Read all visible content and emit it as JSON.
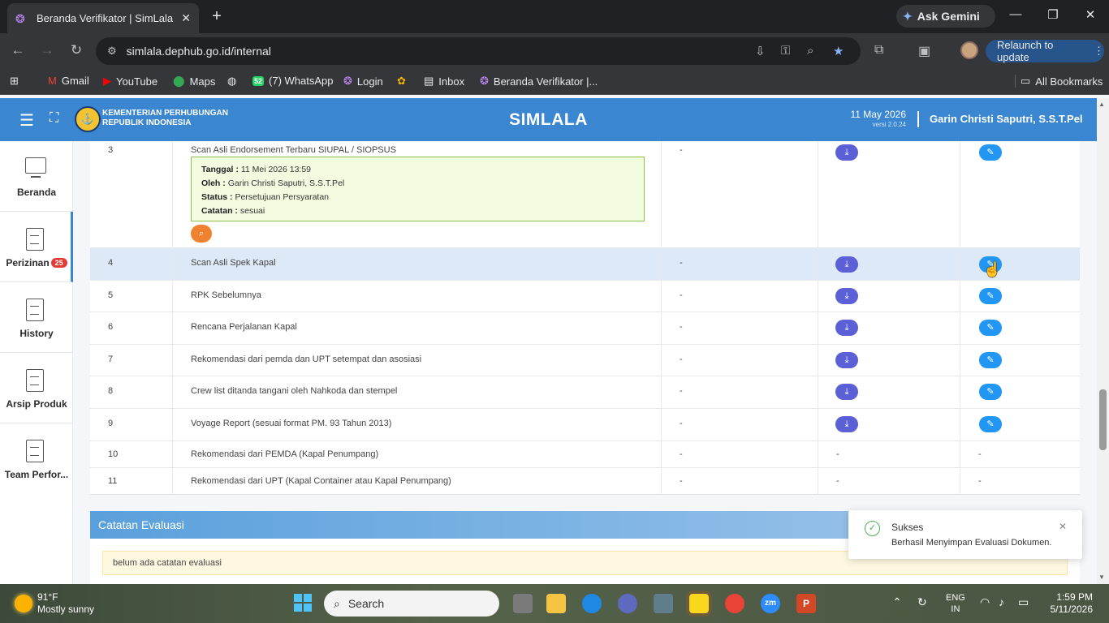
{
  "browser": {
    "tab_title": "Beranda Verifikator | SimLala",
    "ask_gemini": "Ask Gemini",
    "url": "simlala.dephub.go.id/internal",
    "relaunch": "Relaunch to update",
    "bookmarks": [
      "Gmail",
      "YouTube",
      "Maps",
      "(7) WhatsApp",
      "Login",
      "Inbox",
      "Beranda Verifikator |..."
    ],
    "whatsapp_badge": "52",
    "all_bookmarks": "All Bookmarks"
  },
  "header": {
    "ministry_line1": "KEMENTERIAN PERHUBUNGAN",
    "ministry_line2": "REPUBLIK INDONESIA",
    "app_title": "SIMLALA",
    "date": "11 May 2026",
    "version": "versi 2.0.24",
    "user": "Garin Christi Saputri, S.S.T.Pel"
  },
  "sidebar": {
    "items": [
      {
        "label": "Beranda",
        "icon": "monitor-icon"
      },
      {
        "label": "Perizinan",
        "icon": "document-icon",
        "badge": "25"
      },
      {
        "label": "History",
        "icon": "document-icon"
      },
      {
        "label": "Arsip Produk",
        "icon": "document-icon"
      },
      {
        "label": "Team Perfor...",
        "icon": "document-icon"
      }
    ]
  },
  "table": {
    "rows": [
      {
        "no": "3",
        "name": "Scan Asli Endorsement Terbaru SIUPAL / SIOPSUS",
        "dash": "-",
        "has_actions": true
      },
      {
        "no": "4",
        "name": "Scan Asli Spek Kapal",
        "dash": "-",
        "has_actions": true
      },
      {
        "no": "5",
        "name": "RPK Sebelumnya",
        "dash": "-",
        "has_actions": true
      },
      {
        "no": "6",
        "name": "Rencana Perjalanan Kapal",
        "dash": "-",
        "has_actions": true
      },
      {
        "no": "7",
        "name": "Rekomendasi dari pemda dan UPT setempat dan asosiasi",
        "dash": "-",
        "has_actions": true
      },
      {
        "no": "8",
        "name": "Crew list ditanda tangani oleh Nahkoda dan stempel",
        "dash": "-",
        "has_actions": true
      },
      {
        "no": "9",
        "name": "Voyage Report (sesuai format PM. 93 Tahun 2013)",
        "dash": "-",
        "has_actions": true
      },
      {
        "no": "10",
        "name": "Rekomendasi dari PEMDA (Kapal Penumpang)",
        "dash": "-",
        "col4": "-",
        "col5": "-"
      },
      {
        "no": "11",
        "name": "Rekomendasi dari UPT (Kapal Container atau Kapal Penumpang)",
        "dash": "-",
        "col4": "-",
        "col5": "-"
      }
    ],
    "note": {
      "tanggal_label": "Tanggal :",
      "tanggal": "11 Mei 2026 13:59",
      "oleh_label": "Oleh :",
      "oleh": "Garin Christi Saputri, S.S.T.Pel",
      "status_label": "Status :",
      "status": "Persetujuan Persyaratan",
      "catatan_label": "Catatan :",
      "catatan": "sesuai"
    }
  },
  "evaluation": {
    "title": "Catatan Evaluasi",
    "empty_note": "belum ada catatan evaluasi"
  },
  "toast": {
    "title": "Sukses",
    "message": "Berhasil Menyimpan Evaluasi Dokumen."
  },
  "taskbar": {
    "temperature": "91°F",
    "weather": "Mostly sunny",
    "search": "Search",
    "lang1": "ENG",
    "lang2": "IN",
    "time": "1:59 PM",
    "date": "5/11/2026"
  },
  "colors": {
    "header_blue": "#3a86d1",
    "download_button": "#5b60d6",
    "edit_button": "#2196f3",
    "highlight_row": "#dde9f6",
    "success_green": "#4caf50"
  }
}
